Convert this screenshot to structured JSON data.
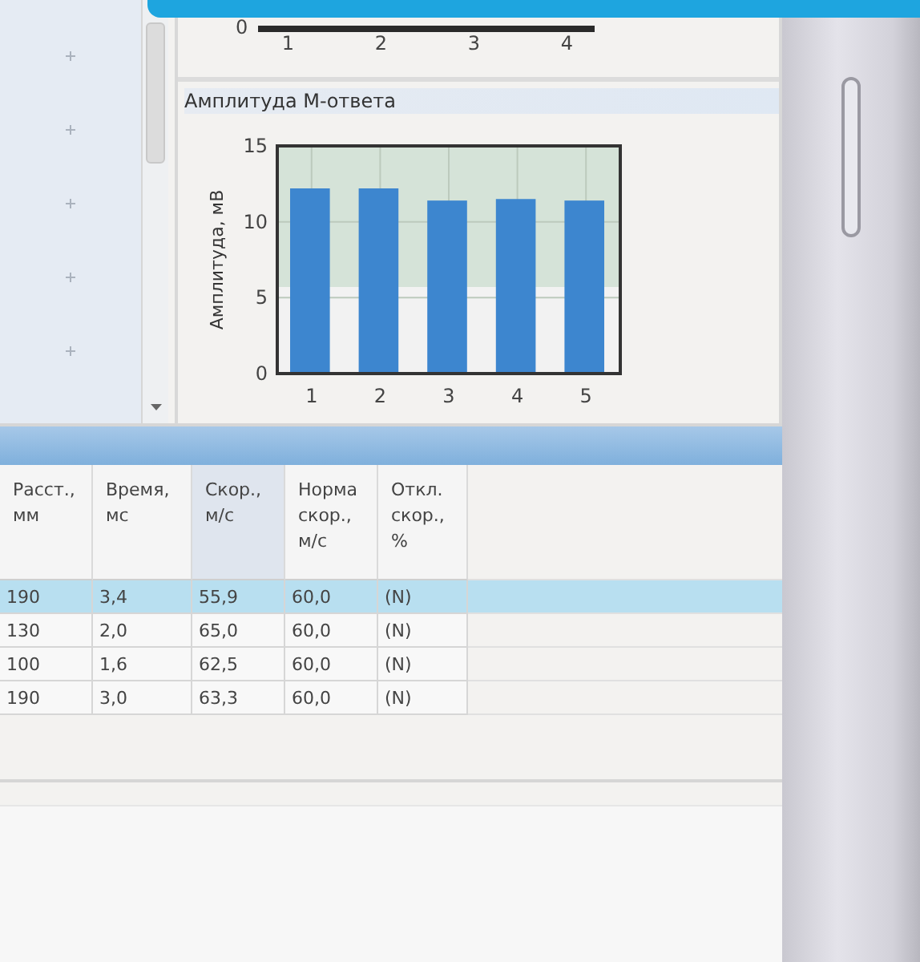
{
  "top_chart": {
    "y_tick": "0",
    "x_ticks": [
      "1",
      "2",
      "3",
      "4"
    ]
  },
  "amplitude_chart": {
    "title": "Амплитуда М-ответа",
    "chart_data": {
      "type": "bar",
      "ylabel": "Амплитуда, мВ",
      "categories": [
        "1",
        "2",
        "3",
        "4",
        "5"
      ],
      "values": [
        12.2,
        12.2,
        11.4,
        11.5,
        11.4
      ],
      "ylim": [
        0,
        15
      ],
      "yticks": [
        0,
        5,
        10,
        15
      ],
      "grid": true
    }
  },
  "table": {
    "columns": [
      {
        "label": "Расст., мм",
        "sorted": false
      },
      {
        "label": "Время, мс",
        "sorted": false
      },
      {
        "label": "Скор., м/с",
        "sorted": true
      },
      {
        "label": "Норма скор., м/с",
        "sorted": false
      },
      {
        "label": "Откл. скор., %",
        "sorted": false
      }
    ],
    "rows": [
      {
        "selected": true,
        "cells": [
          "190",
          "3,4",
          "55,9",
          "60,0",
          "(N)"
        ]
      },
      {
        "selected": false,
        "cells": [
          "130",
          "2,0",
          "65,0",
          "60,0",
          "(N)"
        ]
      },
      {
        "selected": false,
        "cells": [
          "100",
          "1,6",
          "62,5",
          "60,0",
          "(N)"
        ]
      },
      {
        "selected": false,
        "cells": [
          "190",
          "3,0",
          "63,3",
          "60,0",
          "(N)"
        ]
      }
    ]
  }
}
